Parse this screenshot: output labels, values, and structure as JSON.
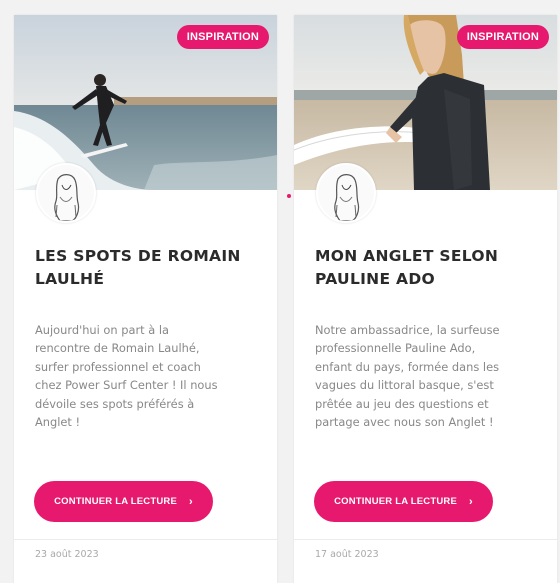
{
  "colors": {
    "accent": "#e6196e",
    "title": "#2b2b2b",
    "text": "#888888",
    "date": "#a9a9a9"
  },
  "cards": [
    {
      "badge": "INSPIRATION",
      "image": "surfer-riding-wave-photo",
      "title_line1": "LES SPOTS DE ROMAIN",
      "title_line2": "LAULHÉ",
      "excerpt": [
        "Aujourd'hui on part à la",
        "rencontre de Romain Laulhé,",
        "surfer professionnel et coach",
        "chez Power Surf Center ! Il nous",
        "dévoile ses spots préférés à",
        "Anglet !"
      ],
      "button_label": "CONTINUER LA LECTURE",
      "button_icon": "chevron-right-icon",
      "date": "23 août 2023"
    },
    {
      "badge": "INSPIRATION",
      "image": "woman-with-surfboard-on-beach-photo",
      "title_line1": "MON ANGLET SELON",
      "title_line2": "PAULINE ADO",
      "excerpt": [
        "Notre ambassadrice, la surfeuse",
        "professionnelle Pauline Ado,",
        "enfant du pays, formée dans les",
        "vagues du littoral basque, s'est",
        "prêtée au jeu des questions et",
        "partage avec nous son Anglet !"
      ],
      "button_label": "CONTINUER LA LECTURE",
      "button_icon": "chevron-right-icon",
      "date": "17 août 2023"
    }
  ]
}
